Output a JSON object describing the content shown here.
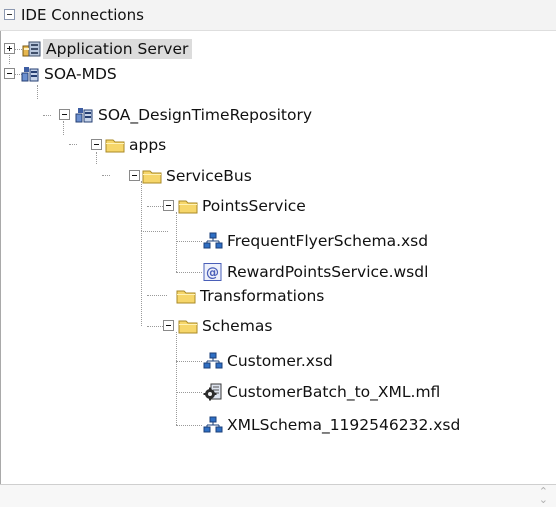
{
  "panel": {
    "title": "IDE Connections"
  },
  "tree": [
    {
      "label": "Application Server",
      "icon": "server-icon",
      "toggle": "plus",
      "selected": true
    },
    {
      "label": "SOA-MDS",
      "icon": "connection-icon",
      "toggle": "minus"
    },
    {
      "label": "SOA_DesignTimeRepository",
      "icon": "connection-icon",
      "toggle": "minus"
    },
    {
      "label": "apps",
      "icon": "folder-icon",
      "toggle": "minus"
    },
    {
      "label": "ServiceBus",
      "icon": "folder-icon",
      "toggle": "minus"
    },
    {
      "label": "PointsService",
      "icon": "folder-icon",
      "toggle": "minus"
    },
    {
      "label": "FrequentFlyerSchema.xsd",
      "icon": "xsd-schema-icon"
    },
    {
      "label": "RewardPointsService.wsdl",
      "icon": "wsdl-icon"
    },
    {
      "label": "Transformations",
      "icon": "folder-icon"
    },
    {
      "label": "Schemas",
      "icon": "folder-icon",
      "toggle": "minus"
    },
    {
      "label": "Customer.xsd",
      "icon": "xsd-schema-icon"
    },
    {
      "label": "CustomerBatch_to_XML.mfl",
      "icon": "mfl-icon"
    },
    {
      "label": "XMLSchema_1192546232.xsd",
      "icon": "xsd-schema-icon"
    }
  ],
  "colors": {
    "selection": "#dcdcdc",
    "folder": "#f6d66a",
    "xsd": "#2f6fc4",
    "wsdl": "#4a5fb8"
  }
}
